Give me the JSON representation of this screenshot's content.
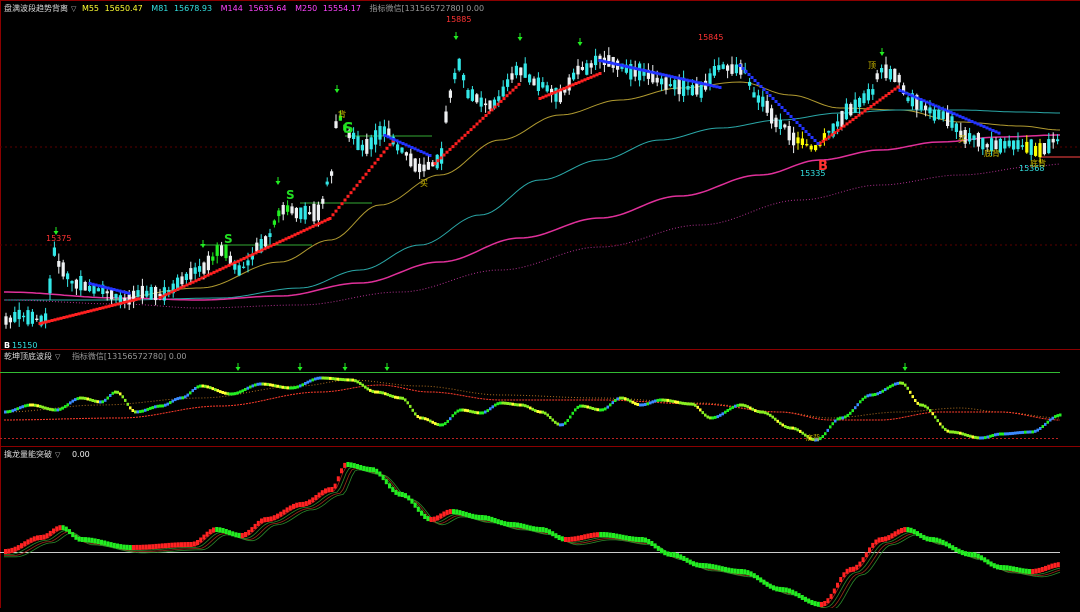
{
  "main_panel": {
    "name": "盘满波段趋势背离",
    "ma": [
      {
        "label": "M55",
        "value": "15650.47",
        "color": "#ffff33"
      },
      {
        "label": "M81",
        "value": "15678.93",
        "color": "#33e0e0"
      },
      {
        "label": "M144",
        "value": "15635.64",
        "color": "#ff44ff"
      },
      {
        "label": "M250",
        "value": "15554.17",
        "color": "#ff44ff"
      }
    ],
    "watermark": "指标微信[13156572780] 0.00",
    "price_labels": [
      {
        "text": "15375",
        "color": "#ff3333"
      },
      {
        "text": "15885",
        "color": "#ff3333"
      },
      {
        "text": "15845",
        "color": "#ff3333"
      },
      {
        "text": "15150",
        "color": "#33e0e0"
      },
      {
        "text": "15335",
        "color": "#33e0e0"
      },
      {
        "text": "15368",
        "color": "#33e0e0"
      }
    ],
    "signals": [
      {
        "text": "S",
        "color": "#22dd22"
      },
      {
        "text": "S",
        "color": "#22dd22"
      },
      {
        "text": "S",
        "color": "#22dd22"
      },
      {
        "text": "B",
        "color": "#ff3333"
      },
      {
        "text": "B",
        "color": "#ffffff"
      }
    ],
    "tags": [
      {
        "text": "背",
        "color": "#d4c000"
      },
      {
        "text": "买",
        "color": "#d4c000"
      },
      {
        "text": "顶",
        "color": "#d4c000"
      },
      {
        "text": "底背",
        "color": "#d4c000"
      },
      {
        "text": "买",
        "color": "#d4c000"
      },
      {
        "text": "底背",
        "color": "#d4c000"
      }
    ]
  },
  "osc_panel": {
    "name": "乾坤顶底波段",
    "watermark": "指标微信[13156572780] 0.00",
    "tag": "底背"
  },
  "vol_panel": {
    "name": "擒龙量能突破",
    "value": "0.00"
  },
  "colors": {
    "up": "#ff2222",
    "down": "#22ee22",
    "cyan": "#33e0e0",
    "blue": "#2233ff",
    "magenta": "#ff44ff",
    "yellow": "#ffff00",
    "olive": "#b09a30",
    "grid": "#8b0000",
    "green_line": "#33aa33"
  }
}
